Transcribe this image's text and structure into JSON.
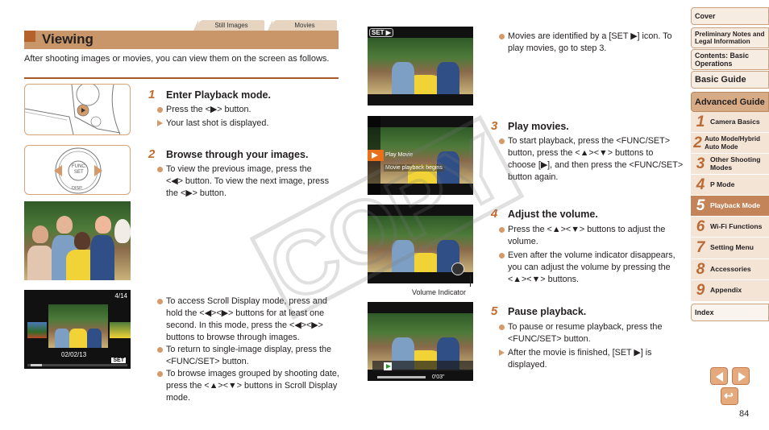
{
  "tabs": [
    "Still Images",
    "Movies"
  ],
  "title": "Viewing",
  "intro": "After shooting images or movies, you can view them on the screen as follows.",
  "steps": [
    {
      "num": "1",
      "title": "Enter Playback mode.",
      "items": [
        {
          "type": "bullet",
          "text": "Press the <▶> button."
        },
        {
          "type": "arrow",
          "text": "Your last shot is displayed."
        }
      ]
    },
    {
      "num": "2",
      "title": "Browse through your images.",
      "items": [
        {
          "type": "bullet",
          "text": "To view the previous image, press the <◀> button. To view the next image, press the <▶> button."
        }
      ]
    },
    {
      "num": "3",
      "title": "Play movies.",
      "items": [
        {
          "type": "bullet",
          "text": "To start playback, press the <FUNC/SET> button, press the <▲><▼> buttons to choose [▶], and then press the <FUNC/SET> button again."
        }
      ]
    },
    {
      "num": "4",
      "title": "Adjust the volume.",
      "items": [
        {
          "type": "bullet",
          "text": "Press the <▲><▼> buttons to adjust the volume."
        },
        {
          "type": "bullet",
          "text": "Even after the volume indicator disappears, you can adjust the volume by pressing the <▲><▼> buttons."
        }
      ]
    },
    {
      "num": "5",
      "title": "Pause playback.",
      "items": [
        {
          "type": "bullet",
          "text": "To pause or resume playback, press the <FUNC/SET> button."
        },
        {
          "type": "arrow",
          "text": "After the movie is finished, [SET ▶] is displayed."
        }
      ]
    }
  ],
  "scroll_notes": [
    "To access Scroll Display mode, press and hold the <◀><▶> buttons for at least one second. In this mode, press the <◀><▶> buttons to browse through images.",
    "To return to single-image display, press the <FUNC/SET> button.",
    "To browse images grouped by shooting date, press the <▲><▼> buttons in Scroll Display mode."
  ],
  "movie_note": "Movies are identified by a [SET ▶] icon. To play movies, go to step 3.",
  "screens": {
    "set_badge": "SET ▶",
    "scroll_counter": "4/14",
    "scroll_date": "02/02/13",
    "menu_item": "Play Movie",
    "menu_hint": "Movie playback begins",
    "volume_caption": "Volume Indicator",
    "playback_time": "0'03\""
  },
  "dial_labels": {
    "func": "FUNC.",
    "set": "SET",
    "disp": "DISP."
  },
  "sidebar": {
    "top": [
      "Cover",
      "Preliminary Notes and Legal Information",
      "Contents: Basic Operations",
      "Basic Guide",
      "Advanced Guide"
    ],
    "chapters": [
      {
        "n": "1",
        "label": "Camera Basics"
      },
      {
        "n": "2",
        "label": "Auto Mode/Hybrid Auto Mode"
      },
      {
        "n": "3",
        "label": "Other Shooting Modes"
      },
      {
        "n": "4",
        "label": "P Mode"
      },
      {
        "n": "5",
        "label": "Playback Mode",
        "active": true
      },
      {
        "n": "6",
        "label": "Wi-Fi Functions"
      },
      {
        "n": "7",
        "label": "Setting Menu"
      },
      {
        "n": "8",
        "label": "Accessories"
      },
      {
        "n": "9",
        "label": "Appendix"
      }
    ],
    "index": "Index"
  },
  "nav": {
    "prev": "◀",
    "next": "▶",
    "back": "↩"
  },
  "page_number": "84",
  "watermark": "COPY",
  "colors": {
    "accent": "#c9966a",
    "accent_dark": "#a85a2a",
    "bullet": "#d49a6a",
    "nav_active": "#c38459"
  }
}
